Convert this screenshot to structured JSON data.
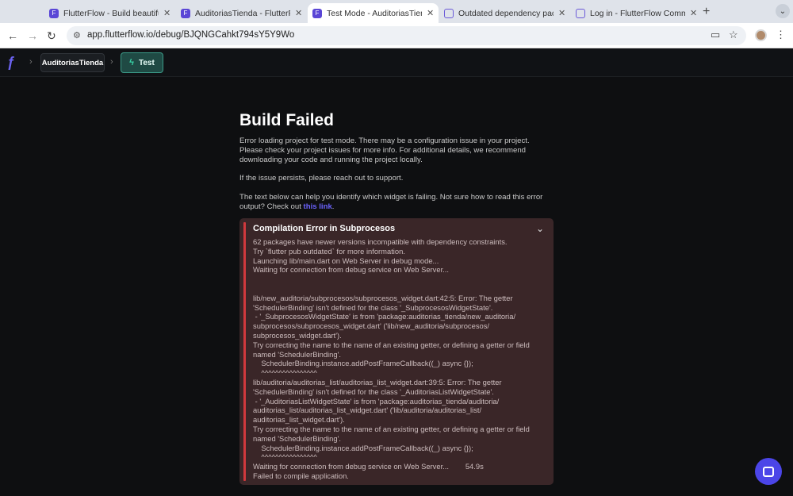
{
  "browser": {
    "tabs": [
      {
        "title": "FlutterFlow - Build beautiful,",
        "active": false,
        "icon": "flutterflow-icon"
      },
      {
        "title": "AuditoriasTienda - FlutterFlow",
        "active": false,
        "icon": "flutterflow-icon"
      },
      {
        "title": "Test Mode - AuditoriasTienda",
        "active": true,
        "icon": "flutterflow-icon"
      },
      {
        "title": "Outdated dependency packag",
        "active": false,
        "icon": "community-icon"
      },
      {
        "title": "Log in - FlutterFlow Commun",
        "active": false,
        "icon": "community-icon"
      }
    ],
    "url": "app.flutterflow.io/debug/BJQNGCahkt794sY5Y9Wo"
  },
  "app_header": {
    "project_name": "AuditoriasTienda",
    "mode_label": "Test"
  },
  "page": {
    "title": "Build Failed",
    "paragraph_1": "Error loading project for test mode. There may be a configuration issue in your project. Please check your project issues for more info. For additional details, we recommend downloading your code and running the project locally.",
    "paragraph_2": "If the issue persists, please reach out to support.",
    "paragraph_3_prefix": "The text below can help you identify which widget is failing. Not sure how to read this error output? Check out ",
    "paragraph_3_link": "this link",
    "paragraph_3_suffix": "."
  },
  "error_panel": {
    "title": "Compilation Error in Subprocesos",
    "body": "62 packages have newer versions incompatible with dependency constraints.\nTry `flutter pub outdated` for more information.\nLaunching lib/main.dart on Web Server in debug mode...\nWaiting for connection from debug service on Web Server...\n\n\nlib/new_auditoria/subprocesos/subprocesos_widget.dart:42:5: Error: The getter\n'SchedulerBinding' isn't defined for the class '_SubprocesosWidgetState'.\n - '_SubprocesosWidgetState' is from 'package:auditorias_tienda/new_auditoria/\nsubprocesos/subprocesos_widget.dart' ('lib/new_auditoria/subprocesos/\nsubprocesos_widget.dart').\nTry correcting the name to the name of an existing getter, or defining a getter or field\nnamed 'SchedulerBinding'.\n    SchedulerBinding.instance.addPostFrameCallback((_) async {});\n    ^^^^^^^^^^^^^^^^\nlib/auditoria/auditorias_list/auditorias_list_widget.dart:39:5: Error: The getter\n'SchedulerBinding' isn't defined for the class '_AuditoriasListWidgetState'.\n - '_AuditoriasListWidgetState' is from 'package:auditorias_tienda/auditoria/\nauditorias_list/auditorias_list_widget.dart' ('lib/auditoria/auditorias_list/\nauditorias_list_widget.dart').\nTry correcting the name to the name of an existing getter, or defining a getter or field\nnamed 'SchedulerBinding'.\n    SchedulerBinding.instance.addPostFrameCallback((_) async {});\n    ^^^^^^^^^^^^^^^^\nWaiting for connection from debug service on Web Server...        54.9s\nFailed to compile application."
  },
  "colors": {
    "background": "#0e0f11",
    "accent": "#6c63ff",
    "error_bar": "#d0393d",
    "error_panel_bg": "#3a2628",
    "test_chip_bg": "#1f4a44"
  }
}
